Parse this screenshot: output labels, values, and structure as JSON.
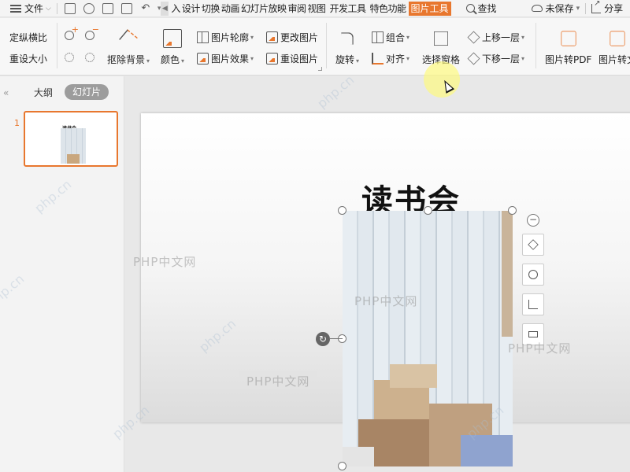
{
  "menubar": {
    "file_label": "文件",
    "tabs": [
      "插入",
      "设计",
      "切换",
      "动画",
      "幻灯片放映",
      "审阅",
      "视图",
      "开发工具",
      "特色功能"
    ],
    "tabs_visible": [
      "入",
      "设计",
      "切换",
      "动画",
      "幻灯片放映",
      "审阅",
      "视图",
      "开发工具",
      "特色功能"
    ],
    "active_tab": "图片工具",
    "search_label": "查找",
    "unsaved_label": "未保存",
    "share_label": "分享"
  },
  "ribbon": {
    "lock_ratio": "定纵横比",
    "reset_size": "重设大小",
    "remove_bg": "抠除背景",
    "color": "颜色",
    "outline": "图片轮廓",
    "effect": "图片效果",
    "change_pic": "更改图片",
    "reset_pic": "重设图片",
    "rotate": "旋转",
    "group": "组合",
    "align": "对齐",
    "selection_pane": "选择窗格",
    "bring_forward": "上移一层",
    "send_backward": "下移一层",
    "to_pdf": "图片转PDF",
    "to_text": "图片转文"
  },
  "panel": {
    "tab_outline": "大纲",
    "tab_slides": "幻灯片",
    "slide_number": "1",
    "thumb_title": "读书会"
  },
  "slide": {
    "title": "读书会"
  },
  "watermarks": {
    "text": "PHP中文网",
    "diag": "php.cn"
  },
  "colors": {
    "accent": "#e8772e"
  }
}
